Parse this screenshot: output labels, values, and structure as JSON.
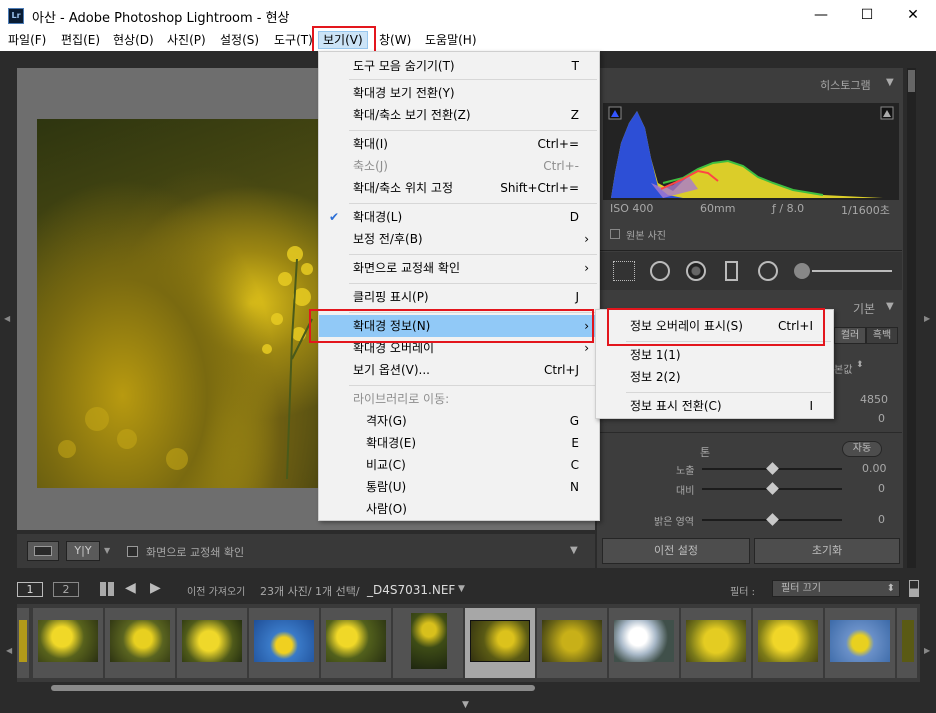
{
  "window": {
    "title": "아산 - Adobe Photoshop Lightroom - 현상",
    "logo": "Lr",
    "min": "—",
    "max": "☐",
    "close": "✕"
  },
  "menubar": [
    "파일(F)",
    "편집(E)",
    "현상(D)",
    "사진(P)",
    "설정(S)",
    "도구(T)",
    "보기(V)",
    "창(W)",
    "도움말(H)"
  ],
  "view_menu": [
    {
      "label": "도구 모음 숨기기(T)",
      "shortcut": "T"
    },
    {
      "label": "확대경 보기 전환(Y)",
      "shortcut": ""
    },
    {
      "label": "확대/축소 보기 전환(Z)",
      "shortcut": "Z"
    },
    {
      "label": "확대(I)",
      "shortcut": "Ctrl+="
    },
    {
      "label": "축소(J)",
      "shortcut": "Ctrl+-",
      "disabled": true
    },
    {
      "label": "확대/축소 위치 고정",
      "shortcut": "Shift+Ctrl+="
    },
    {
      "label": "확대경(L)",
      "shortcut": "D",
      "checked": true
    },
    {
      "label": "보정 전/후(B)",
      "shortcut": "",
      "submenu": true
    },
    {
      "label": "화면으로 교정쇄 확인",
      "shortcut": "",
      "submenu": true
    },
    {
      "label": "클리핑 표시(P)",
      "shortcut": "J"
    },
    {
      "label": "확대경 정보(N)",
      "shortcut": "",
      "submenu": true,
      "highlighted": true
    },
    {
      "label": "확대경 오버레이",
      "shortcut": "",
      "submenu": true
    },
    {
      "label": "보기 옵션(V)...",
      "shortcut": "Ctrl+J"
    },
    {
      "label": "라이브러리로 이동:",
      "shortcut": "",
      "disabled": true
    },
    {
      "label": "격자(G)",
      "shortcut": "G",
      "indent": true
    },
    {
      "label": "확대경(E)",
      "shortcut": "E",
      "indent": true
    },
    {
      "label": "비교(C)",
      "shortcut": "C",
      "indent": true
    },
    {
      "label": "통람(U)",
      "shortcut": "N",
      "indent": true
    },
    {
      "label": "사람(O)",
      "shortcut": "",
      "indent": true
    }
  ],
  "submenu": [
    {
      "label": "정보 오버레이 표시(S)",
      "shortcut": "Ctrl+I"
    },
    {
      "label": "정보 1(1)",
      "shortcut": ""
    },
    {
      "label": "정보 2(2)",
      "shortcut": ""
    },
    {
      "label": "정보 표시 전환(C)",
      "shortcut": "I"
    }
  ],
  "right_panel": {
    "histogram_title": "히스토그램",
    "histogram_info": {
      "iso": "ISO 400",
      "focal": "60mm",
      "aperture": "ƒ / 8.0",
      "shutter": "1/1600초"
    },
    "original_photo": "원본 사진",
    "basic_title": "기본",
    "color_tab": "컬러",
    "bw_tab": "흑백",
    "wb_value": "본값",
    "temp_value": "4850",
    "tint_value": "0",
    "tone_label": "톤",
    "auto_button": "자동",
    "exposure_label": "노출",
    "exposure_value": "0.00",
    "contrast_label": "대비",
    "contrast_value": "0",
    "highlights_label": "밝은 영역",
    "highlights_value": "0",
    "prev_button": "이전 설정",
    "reset_button": "초기화"
  },
  "center_toolbar": {
    "proof_label": "화면으로 교정쇄 확인"
  },
  "filmstrip_bar": {
    "page1": "1",
    "page2": "2",
    "source": "이전 가져오기",
    "count": "23개 사진/ 1개 선택/",
    "filename": "_D4S7031.NEF",
    "filter_label": "필터 :",
    "filter_value": "필터 끄기"
  }
}
